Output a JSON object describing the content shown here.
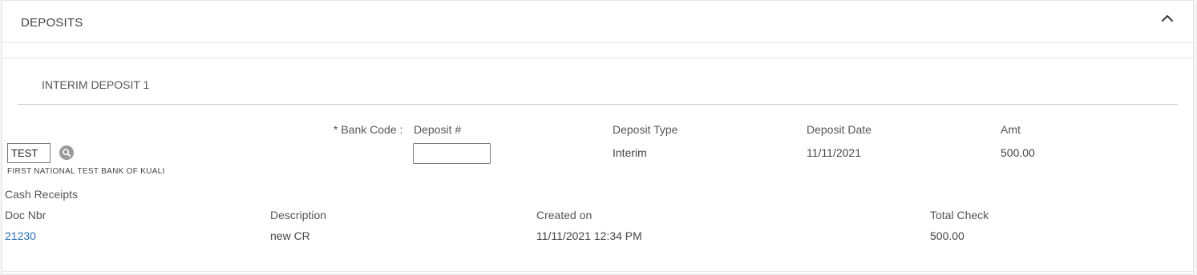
{
  "panel": {
    "title": "DEPOSITS",
    "collapse_icon": "chevron-up-icon"
  },
  "deposit": {
    "title": "INTERIM DEPOSIT 1",
    "labels": {
      "bank_code": "* Bank Code :",
      "deposit_number": "Deposit #",
      "deposit_type": "Deposit Type",
      "deposit_date": "Deposit Date",
      "amount": "Amt"
    },
    "bank_code_value": "TEST",
    "bank_name": "FIRST NATIONAL TEST BANK OF KUALI",
    "deposit_number_value": "",
    "deposit_type_value": "Interim",
    "deposit_date_value": "11/11/2021",
    "amount_value": "500.00"
  },
  "cash_receipts": {
    "title": "Cash Receipts",
    "columns": [
      "Doc Nbr",
      "Description",
      "Created on",
      "Total Check"
    ],
    "rows": [
      {
        "doc_nbr": "21230",
        "description": "new CR",
        "created_on": "11/11/2021 12:34 PM",
        "total_check": "500.00"
      }
    ]
  },
  "colors": {
    "link": "#2a6fb5",
    "icon_gray": "#9a9a9a"
  }
}
